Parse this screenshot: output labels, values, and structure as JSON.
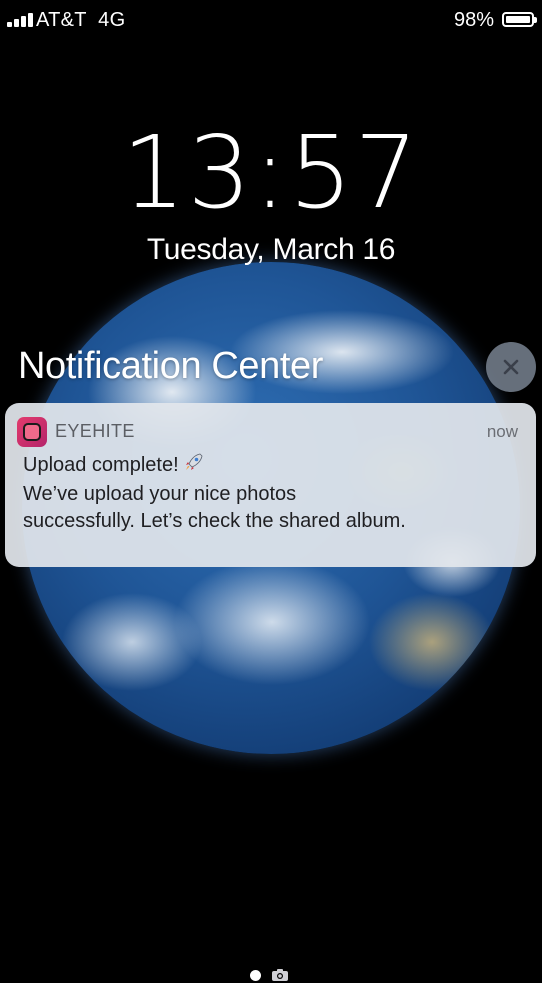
{
  "status_bar": {
    "carrier": "AT&T  4G",
    "battery_percent": "98%",
    "battery_level": 0.98,
    "signal_bars": 4
  },
  "lock_screen": {
    "time": "13:57",
    "date": "Tuesday, March 16"
  },
  "notification_center": {
    "title": "Notification Center",
    "close_icon": "close-icon"
  },
  "notification": {
    "app_name": "EYEHITE",
    "time": "now",
    "line1": "Upload complete!",
    "line1_emoji": "rocket-icon",
    "line2": "We’ve upload your nice photos",
    "line3": "successfully. Let’s check the shared album.",
    "app_icon_color": "#d8305f"
  },
  "page_indicator": {
    "current_icon": "page-dot-icon",
    "camera_icon": "camera-icon"
  },
  "colors": {
    "background": "#000000",
    "notification_bg": "#e2e6ec",
    "close_button_bg": "#78829a"
  }
}
